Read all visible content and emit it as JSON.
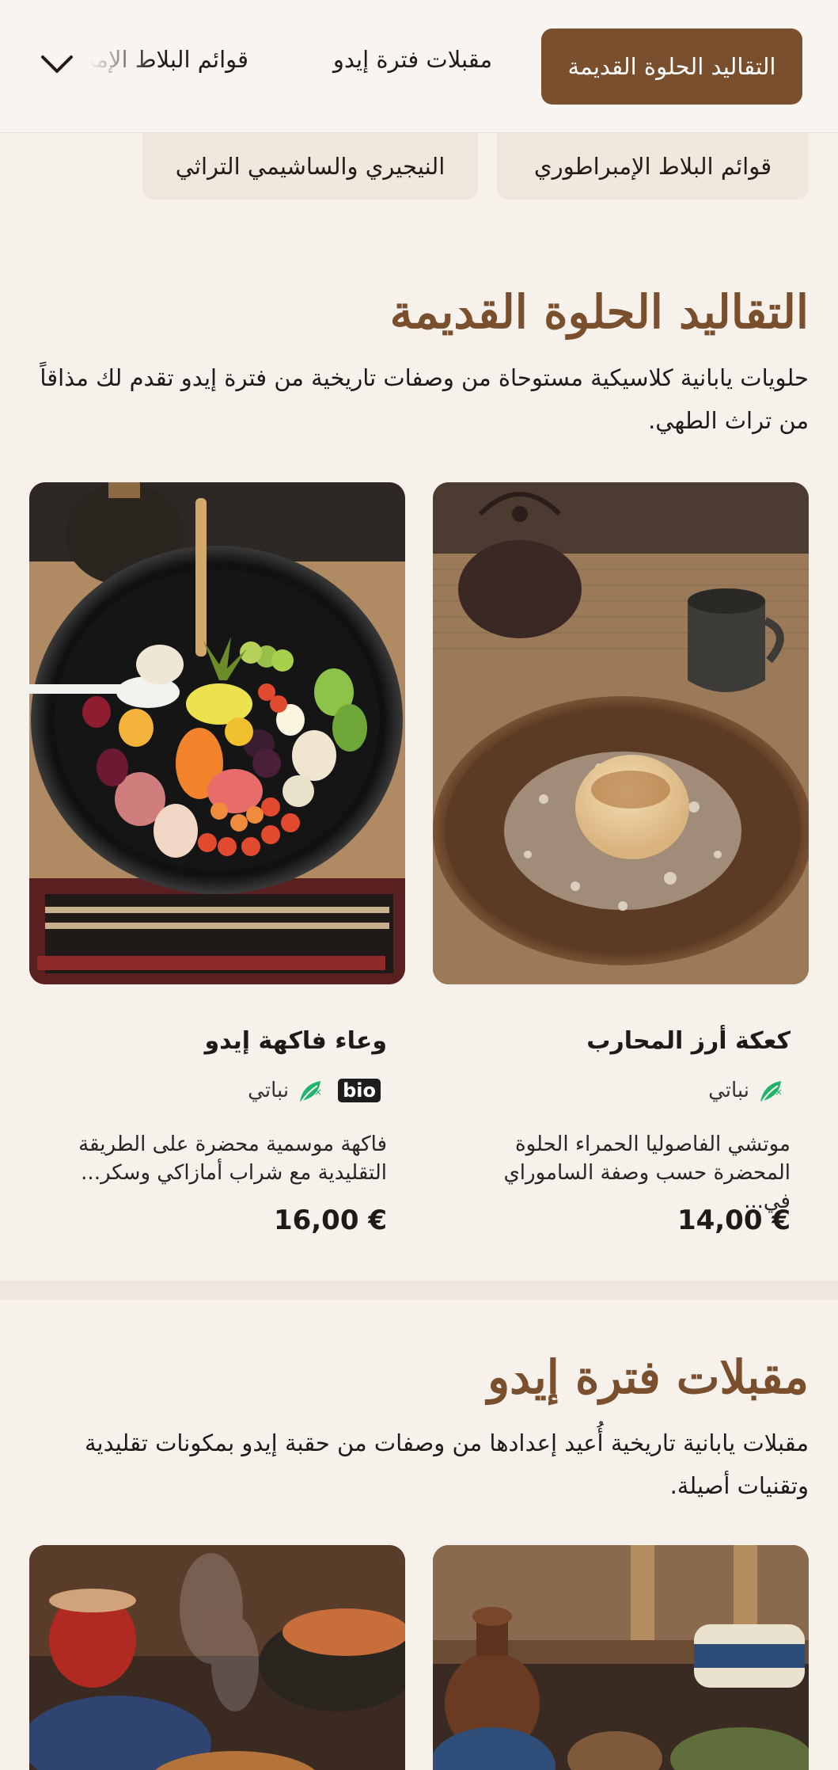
{
  "nav": {
    "active": "التقاليد الحلوة القديمة",
    "link1": "مقبلات فترة إيدو",
    "link2": "قوائم البلاط الإمبراطوري"
  },
  "subnav": {
    "pill1": "قوائم البلاط الإمبراطوري",
    "pill2": "النيجيري والساشيمي التراثي"
  },
  "section1": {
    "title": "التقاليد الحلوة القديمة",
    "description": "حلويات يابانية كلاسيكية مستوحاة من وصفات تاريخية من فترة إيدو تقدم لك مذاقاً من تراث الطهي.",
    "items": [
      {
        "name": "كعكة أرز المحارب",
        "veg_label": "نباتي",
        "description": "موتشي الفاصوليا الحمراء الحلوة المحضرة حسب وصفة الساموراي في...",
        "price": "14,00 €"
      },
      {
        "name": "وعاء فاكهة إيدو",
        "badge": "bio",
        "veg_label": "نباتي",
        "description": "فاكهة موسمية محضرة على الطريقة التقليدية مع شراب أمازاكي وسكر...",
        "price": "16,00 €"
      }
    ]
  },
  "section2": {
    "title": "مقبلات فترة إيدو",
    "description": "مقبلات يابانية تاريخية أُعيد إعدادها من وصفات من حقبة إيدو بمكونات تقليدية وتقنيات أصيلة."
  },
  "colors": {
    "accent": "#7a4f2e",
    "background": "#f6f1ea",
    "vegan_icon": "#1fb36b"
  },
  "icons": [
    "chevron-down-icon",
    "vegan-leaf-icon"
  ]
}
